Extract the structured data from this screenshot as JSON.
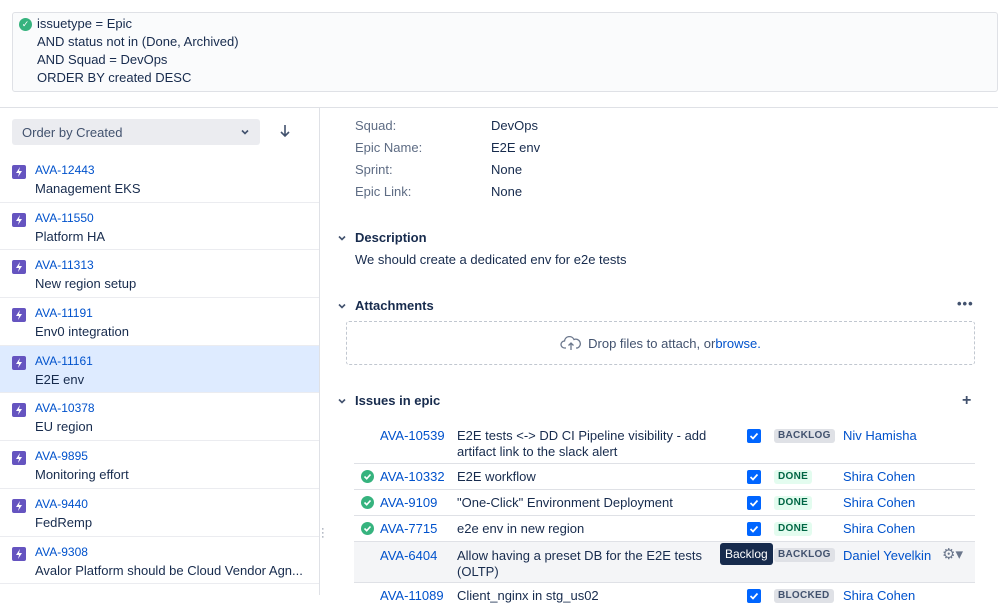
{
  "jql": {
    "status_icon": "check-circle-icon",
    "lines": [
      "issuetype = Epic",
      "AND status not in (Done, Archived)",
      "AND Squad = DevOps",
      "ORDER BY created DESC"
    ]
  },
  "sidebar": {
    "order_select": "Order by Created",
    "sort_icon": "arrow-down-icon",
    "items": [
      {
        "key": "AVA-12443",
        "summary": "Management EKS"
      },
      {
        "key": "AVA-11550",
        "summary": "Platform HA"
      },
      {
        "key": "AVA-11313",
        "summary": "New region setup"
      },
      {
        "key": "AVA-11191",
        "summary": "Env0 integration"
      },
      {
        "key": "AVA-11161",
        "summary": "E2E env",
        "selected": true
      },
      {
        "key": "AVA-10378",
        "summary": "EU region"
      },
      {
        "key": "AVA-9895",
        "summary": "Monitoring effort"
      },
      {
        "key": "AVA-9440",
        "summary": "FedRemp"
      },
      {
        "key": "AVA-9308",
        "summary": "Avalor Platform should be Cloud Vendor Agn..."
      }
    ]
  },
  "details": {
    "fields": [
      {
        "label": "Squad:",
        "value": "DevOps"
      },
      {
        "label": "Epic Name:",
        "value": "E2E env"
      },
      {
        "label": "Sprint:",
        "value": "None"
      },
      {
        "label": "Epic Link:",
        "value": "None"
      }
    ],
    "description": {
      "title": "Description",
      "text": "We should create a dedicated env for e2e tests"
    },
    "attachments": {
      "title": "Attachments",
      "more": "•••",
      "drop_text": "Drop files to attach, or ",
      "browse_link": "browse."
    },
    "issues_in_epic": {
      "title": "Issues in epic",
      "add": "+",
      "rows": [
        {
          "key": "AVA-10539",
          "summary": "E2E tests <-> DD CI Pipeline visibility - add artifact link to the slack alert",
          "status": "BACKLOG",
          "assignee": "Niv Hamisha",
          "done": false
        },
        {
          "key": "AVA-10332",
          "summary": "E2E workflow",
          "status": "DONE",
          "assignee": "Shira Cohen",
          "done": true
        },
        {
          "key": "AVA-9109",
          "summary": "\"One-Click\" Environment Deployment",
          "status": "DONE",
          "assignee": "Shira Cohen",
          "done": true
        },
        {
          "key": "AVA-7715",
          "summary": "e2e env in new region",
          "status": "DONE",
          "assignee": "Shira Cohen",
          "done": true
        },
        {
          "key": "AVA-6404",
          "summary": "Allow having a preset DB for the E2E tests (OLTP)",
          "status": "BACKLOG",
          "assignee": "Daniel Yevelkin",
          "done": false
        },
        {
          "key": "AVA-11089",
          "summary": "Client_nginx in stg_us02",
          "status": "BLOCKED",
          "assignee": "Shira Cohen",
          "done": false
        }
      ],
      "tooltip": "Backlog"
    }
  }
}
